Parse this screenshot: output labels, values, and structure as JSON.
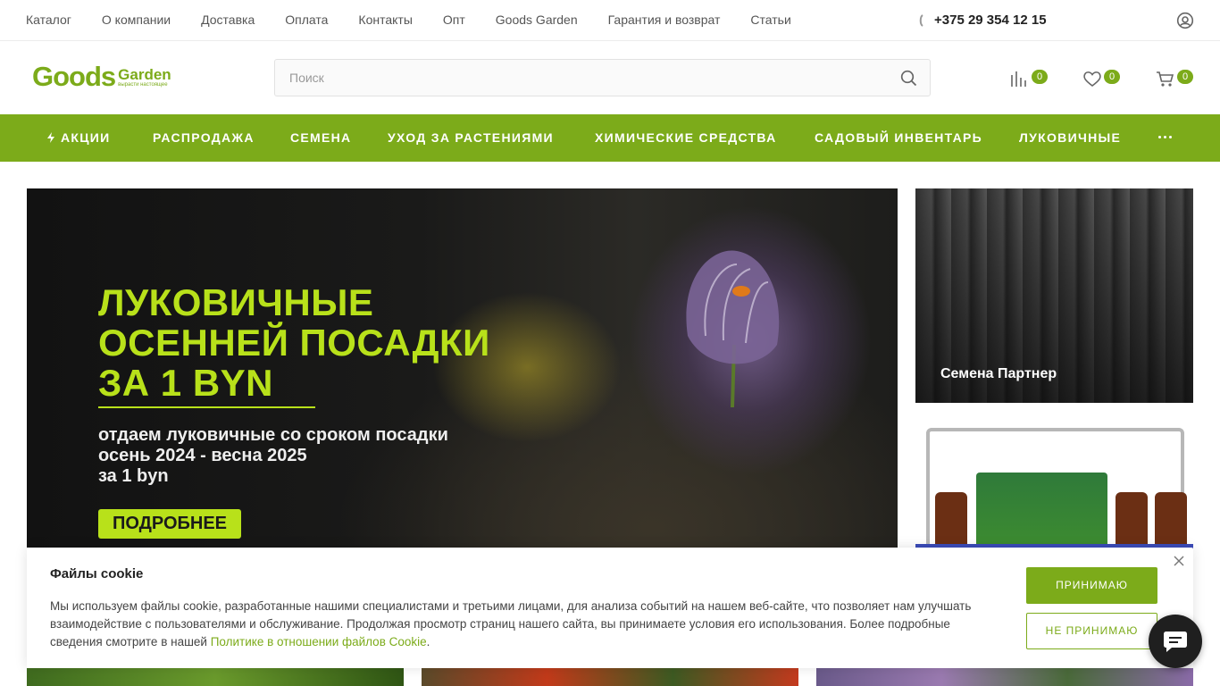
{
  "topnav": {
    "items": [
      "Каталог",
      "О компании",
      "Доставка",
      "Оплата",
      "Контакты",
      "Опт",
      "Goods Garden",
      "Гарантия и возврат",
      "Статьи"
    ],
    "phone": "+375 29 354 12 15"
  },
  "header": {
    "logo_main": "Goods",
    "logo_side": "Garden",
    "logo_tagline": "вырасти настоящее",
    "search_placeholder": "Поиск",
    "compare_count": "0",
    "favorites_count": "0",
    "cart_count": "0"
  },
  "catnav": {
    "items": [
      "АКЦИИ",
      "РАСПРОДАЖА",
      "СЕМЕНА",
      "УХОД ЗА РАСТЕНИЯМИ",
      "ХИМИЧЕСКИЕ СРЕДСТВА",
      "САДОВЫЙ ИНВЕНТАРЬ",
      "ЛУКОВИЧНЫЕ"
    ]
  },
  "hero": {
    "title_line1": "ЛУКОВИЧНЫЕ",
    "title_line2": "ОСЕННЕЙ ПОСАДКИ",
    "title_line3": "ЗА 1 BYN",
    "sub_line1": "отдаем луковичные со сроком посадки",
    "sub_line2": "осень 2024 - весна 2025",
    "sub_line3": "за 1 byn",
    "button": "ПОДРОБНЕЕ"
  },
  "side_banner_1": {
    "label": "Семена Партнер"
  },
  "cookie": {
    "title": "Файлы cookie",
    "text": "Мы используем файлы cookie, разработанные нашими специалистами и третьими лицами, для анализа событий на нашем веб-сайте, что позволяет нам улучшать взаимодействие с пользователями и обслуживание. Продолжая просмотр страниц нашего сайта, вы принимаете условия его использования. Более подробные сведения смотрите в нашей ",
    "link": "Политике в отношении файлов Cookie",
    "text_end": ".",
    "accept": "ПРИНИМАЮ",
    "decline": "НЕ ПРИНИМАЮ"
  },
  "colors": {
    "brand_green": "#7cab1a",
    "hero_accent": "#b8e11a",
    "chat_bg": "#1f1f1f"
  },
  "icons": [
    "phone-icon",
    "user-icon",
    "search-icon",
    "compare-icon",
    "heart-icon",
    "cart-icon",
    "bolt-icon",
    "more-dots-icon",
    "close-icon",
    "chat-icon"
  ]
}
